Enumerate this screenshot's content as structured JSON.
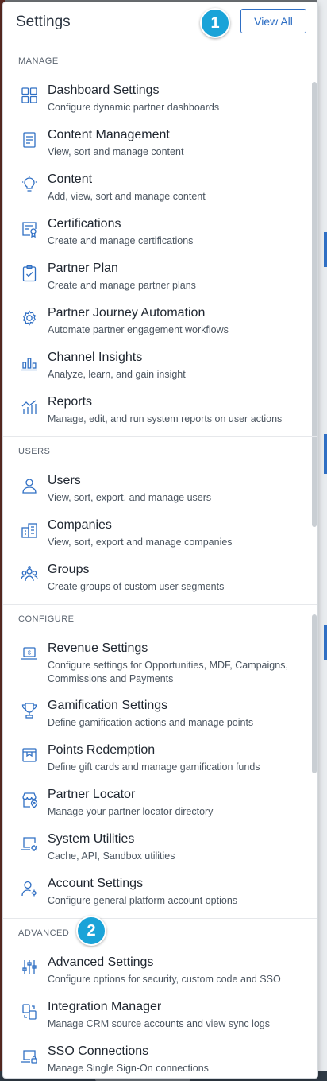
{
  "header": {
    "title": "Settings",
    "view_all": "View All"
  },
  "badges": {
    "one": "1",
    "two": "2"
  },
  "sections": {
    "manage": "MANAGE",
    "users": "USERS",
    "configure": "CONFIGURE",
    "advanced": "ADVANCED"
  },
  "items": {
    "dashboard": {
      "name": "Dashboard Settings",
      "desc": "Configure dynamic partner dashboards",
      "icon": "grid-icon"
    },
    "content_mgmt": {
      "name": "Content Management",
      "desc": "View, sort and manage content",
      "icon": "document-icon"
    },
    "content": {
      "name": "Content",
      "desc": "Add, view, sort and manage content",
      "icon": "lightbulb-icon"
    },
    "certifications": {
      "name": "Certifications",
      "desc": "Create and manage certifications",
      "icon": "certificate-icon"
    },
    "partner_plan": {
      "name": "Partner Plan",
      "desc": "Create and manage partner plans",
      "icon": "clipboard-check-icon"
    },
    "journey": {
      "name": "Partner Journey Automation",
      "desc": "Automate partner engagement workflows",
      "icon": "gear-icon"
    },
    "insights": {
      "name": "Channel Insights",
      "desc": "Analyze, learn, and gain insight",
      "icon": "bar-chart-icon"
    },
    "reports": {
      "name": "Reports",
      "desc": "Manage, edit, and run system reports on user actions",
      "icon": "trend-chart-icon"
    },
    "users": {
      "name": "Users",
      "desc": "View, sort, export, and manage users",
      "icon": "user-icon"
    },
    "companies": {
      "name": "Companies",
      "desc": "View, sort, export and manage companies",
      "icon": "building-icon"
    },
    "groups": {
      "name": "Groups",
      "desc": "Create groups of custom user segments",
      "icon": "group-icon"
    },
    "revenue": {
      "name": "Revenue Settings",
      "desc": "Configure settings for Opportunities, MDF, Campaigns, Commissions and Payments",
      "icon": "laptop-dollar-icon"
    },
    "gamification": {
      "name": "Gamification Settings",
      "desc": "Define gamification actions and manage points",
      "icon": "trophy-icon"
    },
    "points": {
      "name": "Points Redemption",
      "desc": "Define gift cards and manage gamification funds",
      "icon": "gift-card-icon"
    },
    "locator": {
      "name": "Partner Locator",
      "desc": "Manage your partner locator directory",
      "icon": "store-pin-icon"
    },
    "utilities": {
      "name": "System Utilities",
      "desc": "Cache, API, Sandbox utilities",
      "icon": "laptop-gear-icon"
    },
    "account": {
      "name": "Account Settings",
      "desc": "Configure general platform account options",
      "icon": "user-gear-icon"
    },
    "advanced": {
      "name": "Advanced Settings",
      "desc": "Configure options for security, custom code and SSO",
      "icon": "sliders-icon"
    },
    "integration": {
      "name": "Integration Manager",
      "desc": "Manage CRM source accounts and view sync logs",
      "icon": "sync-icon"
    },
    "sso": {
      "name": "SSO Connections",
      "desc": "Manage Single Sign-On connections",
      "icon": "laptop-lock-icon"
    }
  },
  "colors": {
    "accent": "#2f6fc4",
    "badge": "#1aa3d8",
    "text": "#1f2630",
    "muted": "#4b5560"
  }
}
